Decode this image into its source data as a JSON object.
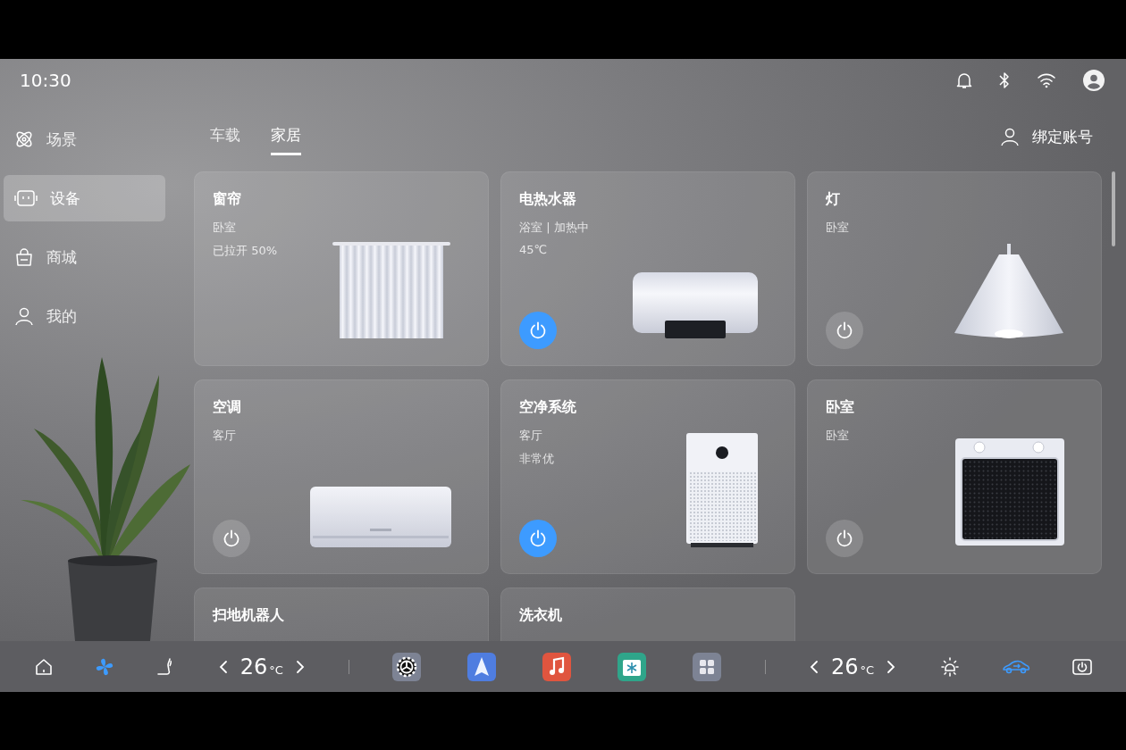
{
  "status_bar": {
    "time": "10:30",
    "icons": [
      {
        "kind": "bell"
      },
      {
        "kind": "bluetooth"
      },
      {
        "kind": "wifi"
      },
      {
        "kind": "avatar"
      }
    ]
  },
  "sidebar": {
    "items": [
      {
        "kind": "scene",
        "label": "场景",
        "selected": false
      },
      {
        "kind": "device",
        "label": "设备",
        "selected": true
      },
      {
        "kind": "shop",
        "label": "商城",
        "selected": false
      },
      {
        "kind": "me",
        "label": "我的",
        "selected": false
      }
    ]
  },
  "tabs": [
    {
      "label": "车载",
      "selected": false
    },
    {
      "label": "家居",
      "selected": true
    }
  ],
  "account": {
    "label": "绑定账号"
  },
  "devices": [
    {
      "kind": "curtain",
      "name": "窗帘",
      "details": [
        "卧室",
        "已拉开 50%"
      ]
    },
    {
      "kind": "water-heater",
      "name": "电热水器",
      "details": [
        "浴室 | 加热中",
        "45℃"
      ],
      "power": true
    },
    {
      "kind": "lamp",
      "name": "灯",
      "details": [
        "卧室"
      ],
      "power": false
    },
    {
      "kind": "air-conditioner",
      "name": "空调",
      "details": [
        "客厅"
      ],
      "power": false
    },
    {
      "kind": "purifier",
      "name": "空净系统",
      "details": [
        "客厅",
        "非常优"
      ],
      "power": true
    },
    {
      "kind": "oven",
      "name": "卧室",
      "details": [
        "卧室"
      ],
      "power": false
    },
    {
      "kind": "robot",
      "name": "扫地机器人"
    },
    {
      "kind": "washer",
      "name": "洗衣机"
    }
  ],
  "dock": {
    "left": [
      {
        "kind": "home",
        "active": false
      },
      {
        "kind": "fan",
        "active": true
      },
      {
        "kind": "seat",
        "active": false
      }
    ],
    "climate_left": {
      "temperature": "26",
      "unit": "°C"
    },
    "apps": [
      {
        "kind": "settings"
      },
      {
        "kind": "navigation"
      },
      {
        "kind": "music"
      },
      {
        "kind": "fridge"
      },
      {
        "kind": "grid"
      }
    ],
    "climate_right": {
      "temperature": "26",
      "unit": "°C"
    },
    "right": [
      {
        "kind": "brightness",
        "active": false
      },
      {
        "kind": "car",
        "active": true
      },
      {
        "kind": "power",
        "active": false
      }
    ]
  }
}
